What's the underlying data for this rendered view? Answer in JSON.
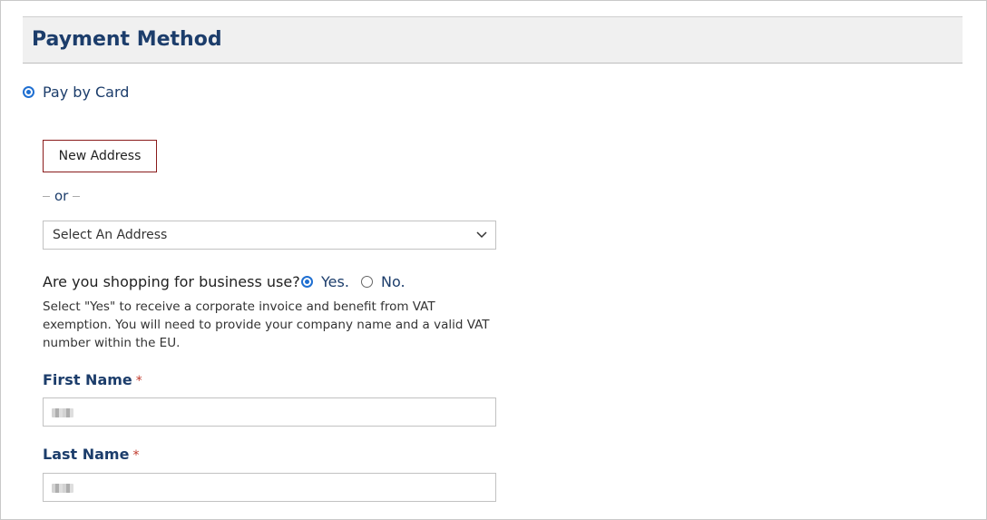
{
  "section": {
    "title": "Payment Method"
  },
  "payment": {
    "option_label": "Pay by Card",
    "selected": true
  },
  "address": {
    "new_button_label": "New Address",
    "or_text": "or",
    "select_value": "Select An Address"
  },
  "business": {
    "question": "Are you shopping for business use?",
    "yes_label": "Yes.",
    "no_label": "No.",
    "selected": "yes",
    "help_text": "Select \"Yes\" to receive a corporate invoice and benefit from VAT exemption. You will need to provide your company name and a valid VAT number within the EU."
  },
  "fields": {
    "first_name": {
      "label": "First Name",
      "required_mark": "*"
    },
    "last_name": {
      "label": "Last Name",
      "required_mark": "*"
    }
  },
  "icons": {
    "select_arrow": "chevron-down-icon"
  },
  "colors": {
    "accent": "#1f6fd1",
    "heading": "#1c3d6b",
    "button_border": "#8a1b1b",
    "required": "#c0392b"
  }
}
